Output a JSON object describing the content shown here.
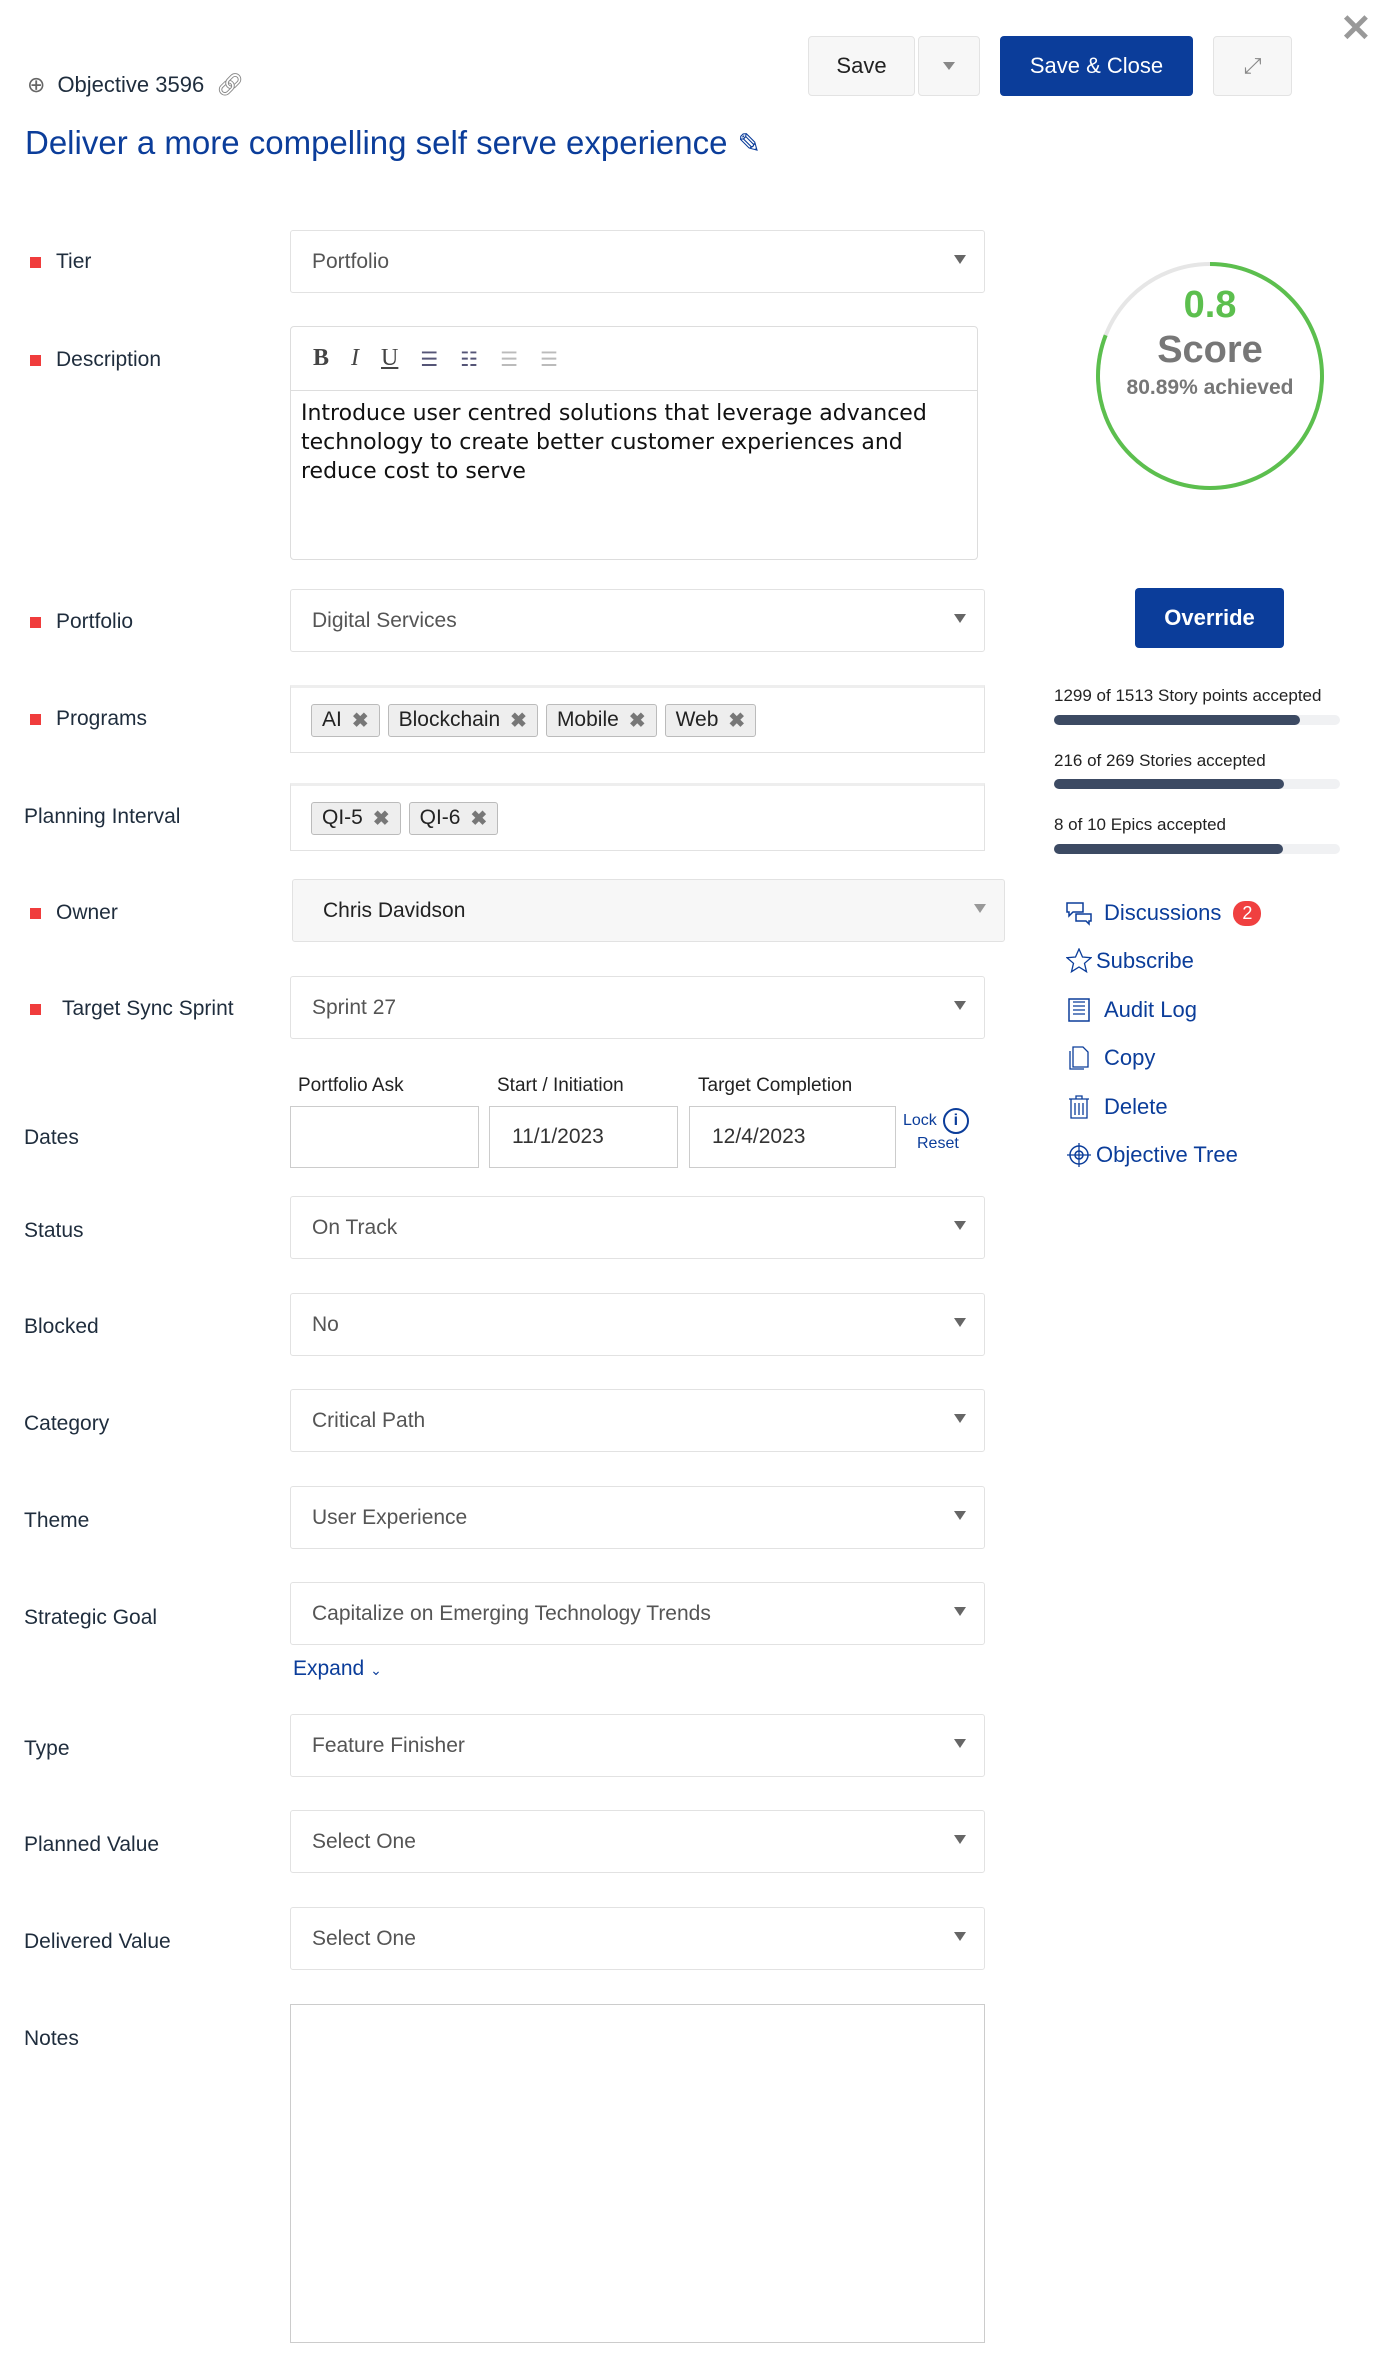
{
  "header": {
    "object_label": "Objective 3596",
    "title": "Deliver a more compelling self serve experience",
    "save_label": "Save",
    "save_close_label": "Save & Close"
  },
  "fields": {
    "tier": {
      "label": "Tier",
      "value": "Portfolio"
    },
    "description": {
      "label": "Description",
      "value": "Introduce user centred solutions that leverage advanced technology to create better customer experiences and reduce cost to serve",
      "toolbar": [
        "B",
        "I",
        "U"
      ]
    },
    "portfolio": {
      "label": "Portfolio",
      "value": "Digital Services"
    },
    "programs": {
      "label": "Programs",
      "tags": [
        "AI",
        "Blockchain",
        "Mobile",
        "Web"
      ]
    },
    "planning_interval": {
      "label": "Planning Interval",
      "tags": [
        "QI-5",
        "QI-6"
      ]
    },
    "owner": {
      "label": "Owner",
      "value": "Chris Davidson"
    },
    "target_sync_sprint": {
      "label": "Target Sync Sprint",
      "value": "Sprint 27"
    },
    "dates": {
      "label": "Dates",
      "portfolio_ask_label": "Portfolio Ask",
      "portfolio_ask": "",
      "start_label": "Start / Initiation",
      "start": "11/1/2023",
      "target_label": "Target Completion",
      "target": "12/4/2023",
      "lock": "Lock",
      "reset": "Reset"
    },
    "status": {
      "label": "Status",
      "value": "On Track"
    },
    "blocked": {
      "label": "Blocked",
      "value": "No"
    },
    "category": {
      "label": "Category",
      "value": "Critical Path"
    },
    "theme": {
      "label": "Theme",
      "value": "User Experience"
    },
    "strategic_goal": {
      "label": "Strategic Goal",
      "value": "Capitalize on Emerging Technology Trends",
      "expand": "Expand"
    },
    "type": {
      "label": "Type",
      "value": "Feature Finisher"
    },
    "planned_value": {
      "label": "Planned Value",
      "value": "Select One"
    },
    "delivered_value": {
      "label": "Delivered Value",
      "value": "Select One"
    },
    "notes": {
      "label": "Notes",
      "value": ""
    }
  },
  "score": {
    "value": "0.8",
    "label": "Score",
    "achieved": "80.89% achieved",
    "fraction": 0.8089,
    "override_label": "Override",
    "color": "#5cbf4e"
  },
  "progress": [
    {
      "text": "1299 of 1513 Story points accepted",
      "fraction": 0.8586
    },
    {
      "text": "216 of 269 Stories accepted",
      "fraction": 0.803
    },
    {
      "text": "8 of 10 Epics accepted",
      "fraction": 0.8
    }
  ],
  "actions": {
    "discussions": "Discussions",
    "discussions_count": "2",
    "subscribe": "Subscribe",
    "audit_log": "Audit Log",
    "copy": "Copy",
    "delete": "Delete",
    "objective_tree": "Objective Tree"
  }
}
